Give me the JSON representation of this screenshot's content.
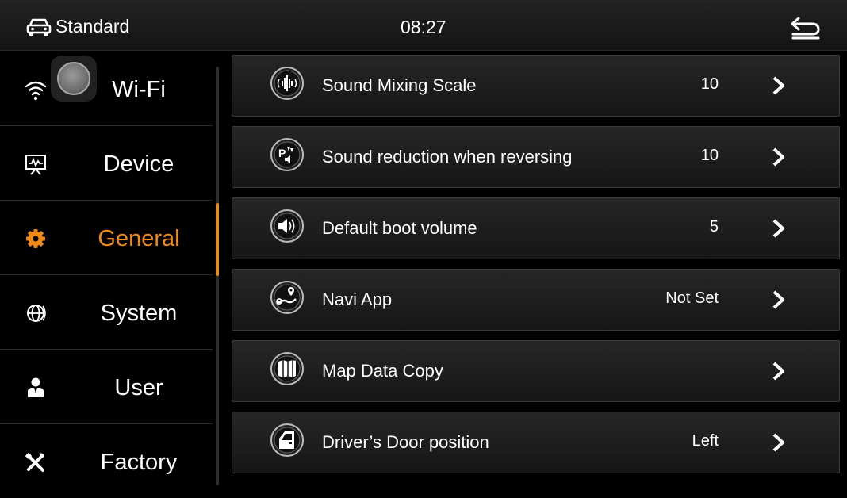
{
  "statusbar": {
    "mode_label": "Standard",
    "time": "08:27",
    "mode_icon": "car-icon",
    "back_icon": "back-icon"
  },
  "sidebar": {
    "items": [
      {
        "label": "Wi-Fi",
        "icon": "wifi-icon",
        "active": false
      },
      {
        "label": "Device",
        "icon": "device-icon",
        "active": false
      },
      {
        "label": "General",
        "icon": "gear-icon",
        "active": true
      },
      {
        "label": "System",
        "icon": "globe-icon",
        "active": false
      },
      {
        "label": "User",
        "icon": "user-icon",
        "active": false
      },
      {
        "label": "Factory",
        "icon": "tools-icon",
        "active": false
      }
    ]
  },
  "settings": {
    "rows": [
      {
        "label": "Sound Mixing Scale",
        "value": "10",
        "icon": "equalizer-icon"
      },
      {
        "label": "Sound reduction when reversing",
        "value": "10",
        "icon": "parking-sound-icon"
      },
      {
        "label": "Default boot volume",
        "value": "5",
        "icon": "speaker-icon"
      },
      {
        "label": "Navi App",
        "value": "Not Set",
        "icon": "navigation-icon"
      },
      {
        "label": "Map Data Copy",
        "value": "",
        "icon": "map-icon"
      },
      {
        "label": "Driver’s Door position",
        "value": "Left",
        "icon": "car-door-icon"
      }
    ]
  },
  "colors": {
    "accent": "#f08a14",
    "background": "#000000",
    "row_background": "#1e1e1e"
  }
}
